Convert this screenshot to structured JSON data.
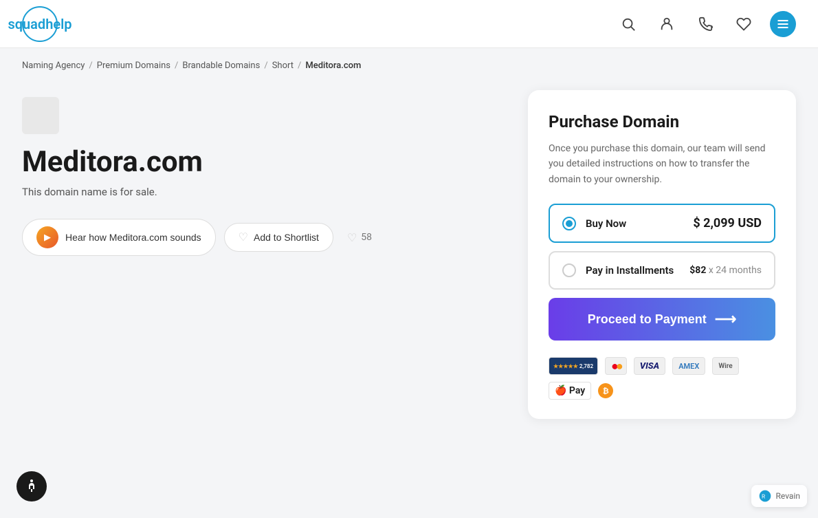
{
  "header": {
    "logo_text_regular": "squad",
    "logo_text_accent": "help",
    "icons": [
      "search",
      "user",
      "phone",
      "heart",
      "menu"
    ]
  },
  "breadcrumb": {
    "items": [
      "Naming Agency",
      "Premium Domains",
      "Brandable Domains",
      "Short",
      "Meditora.com"
    ],
    "separators": [
      "/",
      "/",
      "/",
      "/"
    ]
  },
  "domain": {
    "title": "Meditora.com",
    "subtitle": "This domain name is for sale.",
    "hear_button": "Hear how Meditora.com sounds",
    "shortlist_button": "Add to Shortlist",
    "likes_count": "58"
  },
  "purchase": {
    "title": "Purchase Domain",
    "description": "Once you purchase this domain, our team will send you detailed instructions on how to transfer the domain to your ownership.",
    "option_buy_now": {
      "label": "Buy Now",
      "price": "$ 2,099 USD",
      "selected": true
    },
    "option_installments": {
      "label": "Pay in Installments",
      "amount": "$82",
      "months": "24 months",
      "selected": false
    },
    "proceed_button": "Proceed to Payment",
    "payment_icons": [
      "Verified",
      "Mastercard",
      "VISA",
      "Amex",
      "Wire",
      "Apple Pay",
      "Bitcoin"
    ]
  },
  "accessibility": {
    "label": "♿"
  },
  "revain": {
    "label": "Revain"
  }
}
